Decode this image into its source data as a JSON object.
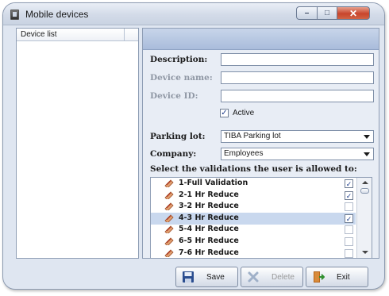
{
  "window": {
    "title": "Mobile devices",
    "icon": "mobile-device-icon"
  },
  "device_list": {
    "header": "Device list",
    "items": []
  },
  "form": {
    "description_label": "Description:",
    "device_name_label": "Device name:",
    "device_id_label": "Device ID:",
    "description_value": "",
    "device_name_value": "",
    "device_id_value": "",
    "active_label": "Active",
    "active_checked": true,
    "parking_lot_label": "Parking lot:",
    "parking_lot_value": "TIBA Parking lot",
    "company_label": "Company:",
    "company_value": "Employees",
    "validations_label": "Select the validations the user is allowed to:"
  },
  "validations": [
    {
      "name": "1-Full Validation",
      "checked": true,
      "selected": false
    },
    {
      "name": "2-1 Hr Reduce",
      "checked": true,
      "selected": false
    },
    {
      "name": "3-2 Hr Reduce",
      "checked": false,
      "selected": false
    },
    {
      "name": "4-3 Hr Reduce",
      "checked": true,
      "selected": true
    },
    {
      "name": "5-4 Hr Reduce",
      "checked": false,
      "selected": false
    },
    {
      "name": "6-5 Hr Reduce",
      "checked": false,
      "selected": false
    },
    {
      "name": "7-6 Hr Reduce",
      "checked": false,
      "selected": false
    }
  ],
  "buttons": {
    "save": "Save",
    "delete": "Delete",
    "exit": "Exit"
  },
  "colors": {
    "panel_header": "#b4c5e0",
    "selection": "#c9d8ee",
    "close_button": "#c8452c"
  }
}
